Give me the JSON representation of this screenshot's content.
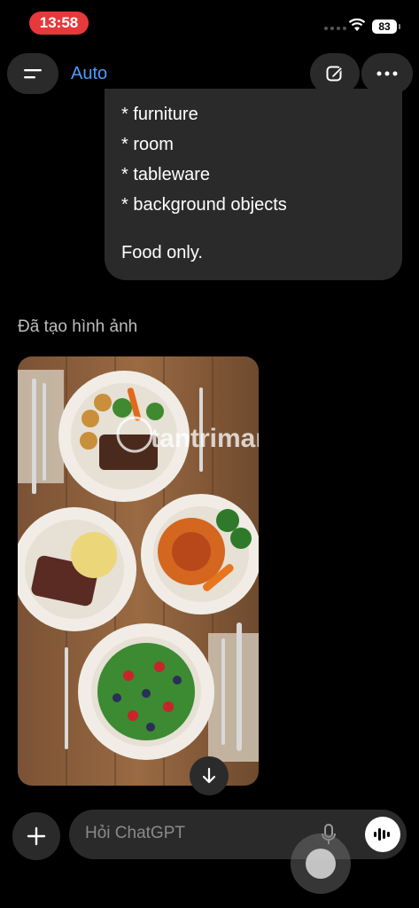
{
  "status_bar": {
    "time": "13:58",
    "battery": "83"
  },
  "header": {
    "model_label": "Auto"
  },
  "message": {
    "lines": [
      "* furniture",
      "* room",
      "* tableware",
      "* background objects"
    ],
    "final": "Food only."
  },
  "assistant": {
    "status": "Đã tạo hình ảnh"
  },
  "image": {
    "watermark": "tantrimang"
  },
  "composer": {
    "placeholder": "Hỏi ChatGPT"
  },
  "colors": {
    "accent": "#4a9cff",
    "time_pill": "#e6393b",
    "surface": "#2a2a2a"
  }
}
